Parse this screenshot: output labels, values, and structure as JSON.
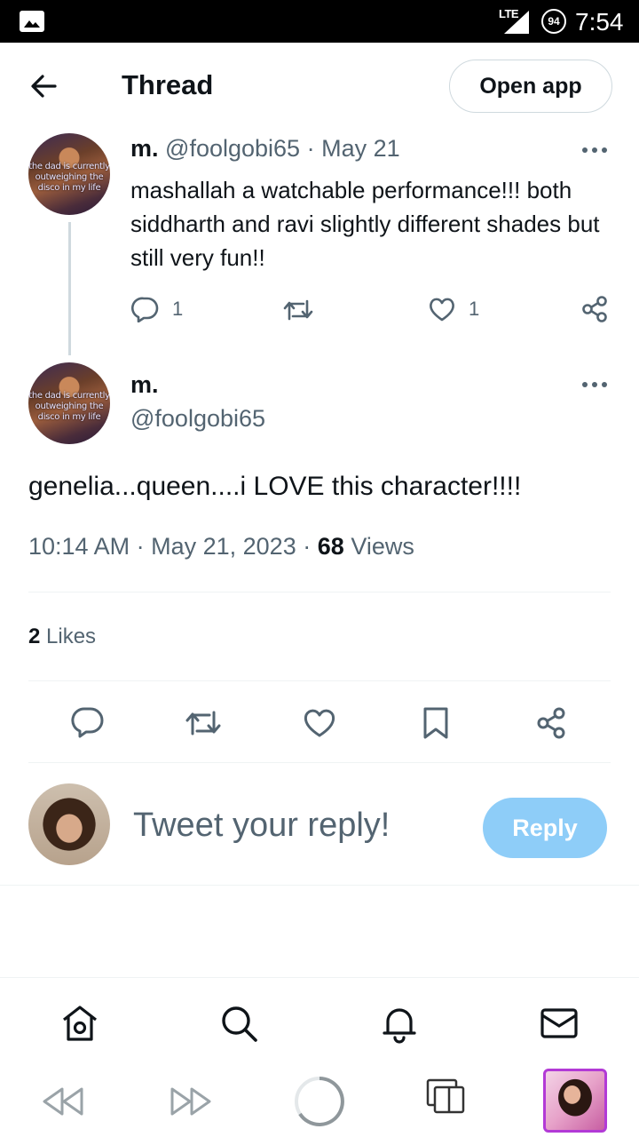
{
  "status_bar": {
    "network": "LTE",
    "battery": "94",
    "time": "7:54"
  },
  "header": {
    "title": "Thread",
    "open_app_label": "Open app"
  },
  "parent_tweet": {
    "name": "m.",
    "handle": "@foolgobi65",
    "date": "May 21",
    "avatar_caption": "the dad is currently outweighing the disco in my life",
    "text": "mashallah a watchable performance!!! both siddharth and ravi slightly different shades but still very fun!!",
    "reply_count": "1",
    "like_count": "1"
  },
  "main_tweet": {
    "name": "m.",
    "handle": "@foolgobi65",
    "avatar_caption": "the dad is currently outweighing the disco in my life",
    "text": "genelia...queen....i LOVE this character!!!!",
    "time": "10:14 AM",
    "date": "May 21, 2023",
    "views_count": "68",
    "views_label": "Views",
    "likes_count": "2",
    "likes_label": "Likes"
  },
  "reply": {
    "placeholder": "Tweet your reply!",
    "button_label": "Reply"
  },
  "icons": {
    "action_color": "#536471",
    "reply_button_color": "#8ecdf8",
    "profile_frame_color": "#b23ad6"
  }
}
